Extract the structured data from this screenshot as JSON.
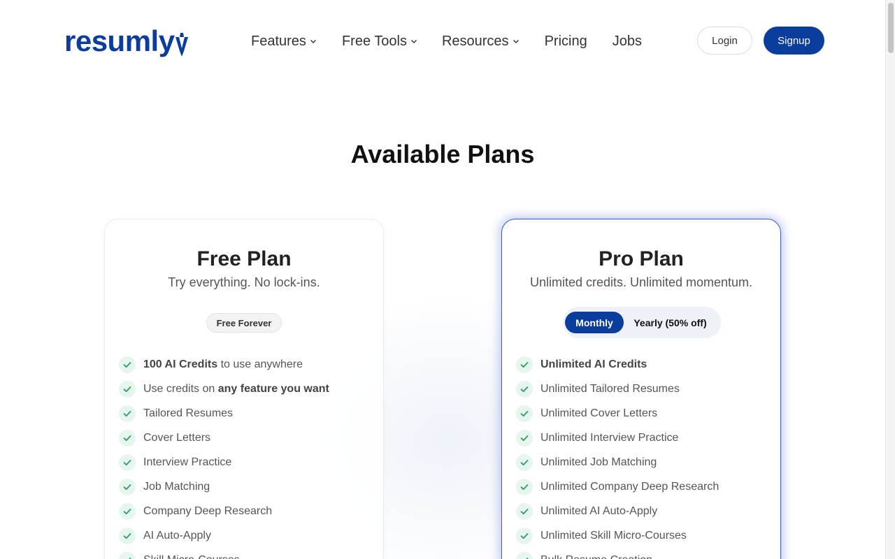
{
  "brand": {
    "logo_text": "resumly",
    "accent": "#0a3d9c"
  },
  "nav": {
    "items": [
      {
        "label": "Features",
        "dropdown": true
      },
      {
        "label": "Free Tools",
        "dropdown": true
      },
      {
        "label": "Resources",
        "dropdown": true
      },
      {
        "label": "Pricing",
        "dropdown": false
      },
      {
        "label": "Jobs",
        "dropdown": false
      }
    ],
    "login_label": "Login",
    "signup_label": "Signup"
  },
  "page": {
    "title": "Available Plans"
  },
  "plans": {
    "free": {
      "title": "Free Plan",
      "subtitle": "Try everything. No lock-ins.",
      "badge": "Free Forever",
      "features": [
        {
          "bold": "100 AI Credits",
          "text": " to use anywhere"
        },
        {
          "pre": "Use credits on ",
          "bold": "any feature you want"
        },
        {
          "text": "Tailored Resumes"
        },
        {
          "text": "Cover Letters"
        },
        {
          "text": "Interview Practice"
        },
        {
          "text": "Job Matching"
        },
        {
          "text": "Company Deep Research"
        },
        {
          "text": "AI Auto-Apply"
        },
        {
          "text": "Skill Micro-Courses"
        }
      ]
    },
    "pro": {
      "title": "Pro Plan",
      "subtitle": "Unlimited credits. Unlimited momentum.",
      "billing_toggle": {
        "monthly_label": "Monthly",
        "yearly_label": "Yearly (50% off)",
        "selected": "Monthly"
      },
      "features": [
        {
          "bold": "Unlimited AI Credits"
        },
        {
          "text": "Unlimited Tailored Resumes"
        },
        {
          "text": "Unlimited Cover Letters"
        },
        {
          "text": "Unlimited Interview Practice"
        },
        {
          "text": "Unlimited Job Matching"
        },
        {
          "text": "Unlimited Company Deep Research"
        },
        {
          "text": "Unlimited AI Auto-Apply"
        },
        {
          "text": "Unlimited Skill Micro-Courses"
        },
        {
          "text": "Bulk Resume Creation"
        }
      ]
    }
  },
  "icons": {
    "check": "check-icon",
    "chevron": "chevron-down-icon",
    "check_color": "#2e9e62"
  }
}
